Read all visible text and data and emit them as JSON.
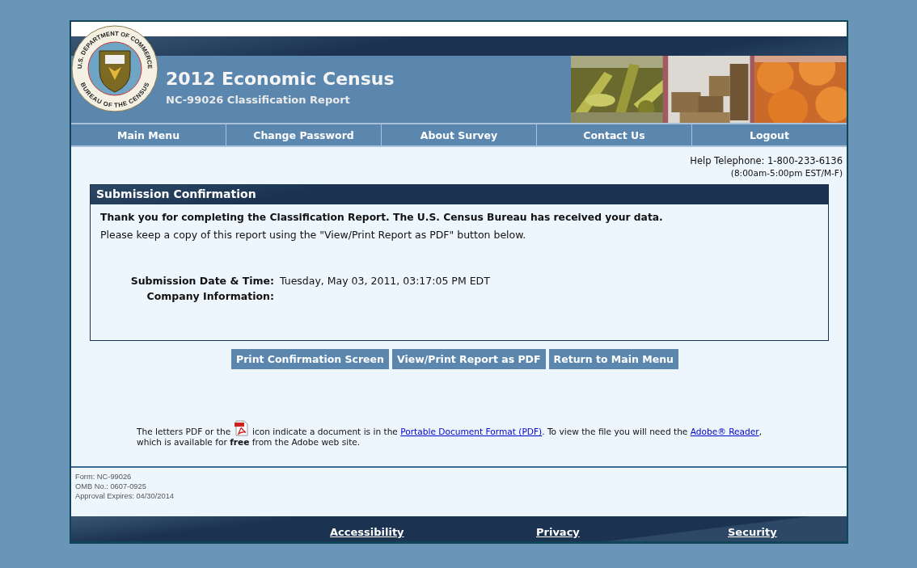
{
  "header": {
    "seal_top": "U.S. DEPARTMENT OF COMMERCE",
    "seal_bottom": "BUREAU OF THE CENSUS",
    "title": "2012 Economic Census",
    "subtitle": "NC-99026 Classification Report"
  },
  "nav": [
    {
      "label": "Main Menu"
    },
    {
      "label": "Change Password"
    },
    {
      "label": "About Survey"
    },
    {
      "label": "Contact Us"
    },
    {
      "label": "Logout"
    }
  ],
  "help": {
    "telephone": "Help Telephone: 1-800-233-6136",
    "hours": "(8:00am-5:00pm EST/M-F)"
  },
  "confirmation": {
    "title": "Submission Confirmation",
    "thanks": "Thank you for completing the Classification Report. The U.S. Census Bureau has received your data.",
    "instruction": "Please keep a copy of this report using the \"View/Print Report as PDF\" button below.",
    "fields": [
      {
        "label": "Submission Date & Time:",
        "value": "Tuesday, May 03, 2011, 03:17:05 PM EDT"
      },
      {
        "label": "Company Information:"
      }
    ]
  },
  "buttons": [
    "Print Confirmation Screen",
    "View/Print Report as PDF",
    "Return to Main Menu"
  ],
  "pdf_note": {
    "before_icon": "The letters PDF or the",
    "after_icon": "icon indicate a document is in the",
    "link_1": "Portable Document Format (PDF)",
    "middle": ". To view the file you will need the",
    "link_2": "Adobe® Reader",
    "end": ", which is available for **free** from the Adobe web site."
  },
  "form_info": [
    "Form: NC-99026",
    "OMB No.: 0607-0925",
    "Approval Expires: 04/30/2014"
  ],
  "footer_links": [
    "Accessibility",
    "Privacy",
    "Security"
  ]
}
